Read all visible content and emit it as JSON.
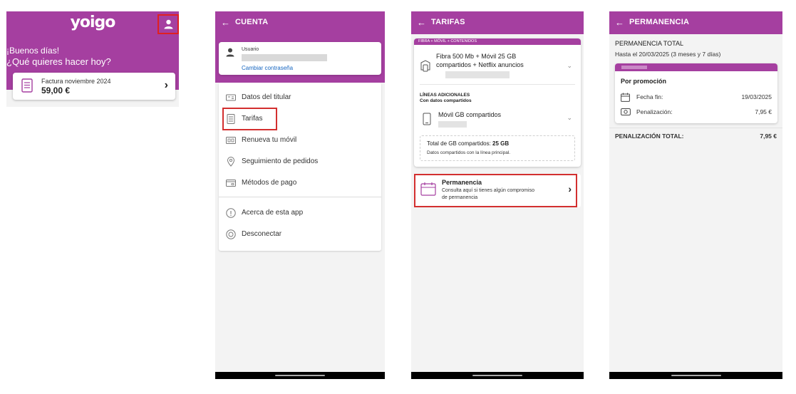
{
  "colors": {
    "brand": "#a53fa0",
    "highlight": "#d32f2f",
    "link": "#1565c0"
  },
  "home": {
    "logo": "yoigo",
    "greeting_line1": "¡Buenos días!",
    "greeting_line2": "¿Qué quieres hacer hoy?",
    "invoice_label": "Factura noviembre 2024",
    "invoice_amount": "59,00 €",
    "profile_icon": "user-icon"
  },
  "account": {
    "back": "←",
    "title": "CUENTA",
    "user_label": "Usuario",
    "change_password": "Cambiar contraseña",
    "menu": [
      {
        "label": "Datos del titular",
        "icon": "id-card-icon"
      },
      {
        "label": "Tarifas",
        "icon": "tariff-icon"
      },
      {
        "label": "Renueva tu móvil",
        "icon": "phone-swap-icon"
      },
      {
        "label": "Seguimiento de pedidos",
        "icon": "location-pin-icon"
      },
      {
        "label": "Métodos de pago",
        "icon": "payment-card-icon"
      },
      {
        "label": "Acerca de esta app",
        "icon": "info-icon"
      },
      {
        "label": "Desconectar",
        "icon": "power-icon"
      }
    ]
  },
  "tariffs": {
    "back": "←",
    "title": "TARIFAS",
    "tag": "FIBRA + MÓVIL + CONTENIDOS",
    "plan_line1": "Fibra 500 Mb + Móvil 25 GB",
    "plan_line2": "compartidos + Netflix anuncios",
    "additional_title": "LÍNEAS ADICIONALES",
    "additional_sub": "Con datos compartidos",
    "mobile_plan": "Móvil GB compartidos",
    "gb_total_prefix": "Total de GB compartidos: ",
    "gb_total_value": "25 GB",
    "gb_note": "Datos compartidos con la línea principal.",
    "permanence_title": "Permanencia",
    "permanence_sub1": "Consulta aquí si tienes algún compromiso",
    "permanence_sub2": "de permanencia"
  },
  "permanence": {
    "back": "←",
    "title": "PERMANENCIA",
    "total_title": "PERMANENCIA TOTAL",
    "until": "Hasta el 20/03/2025 (3 meses y 7 días)",
    "promo_title": "Por promoción",
    "end_date_label": "Fecha fin:",
    "end_date_value": "19/03/2025",
    "penalty_label": "Penalización:",
    "penalty_value": "7,95 €",
    "total_penalty_label": "PENALIZACIÓN TOTAL:",
    "total_penalty_value": "7,95 €"
  }
}
